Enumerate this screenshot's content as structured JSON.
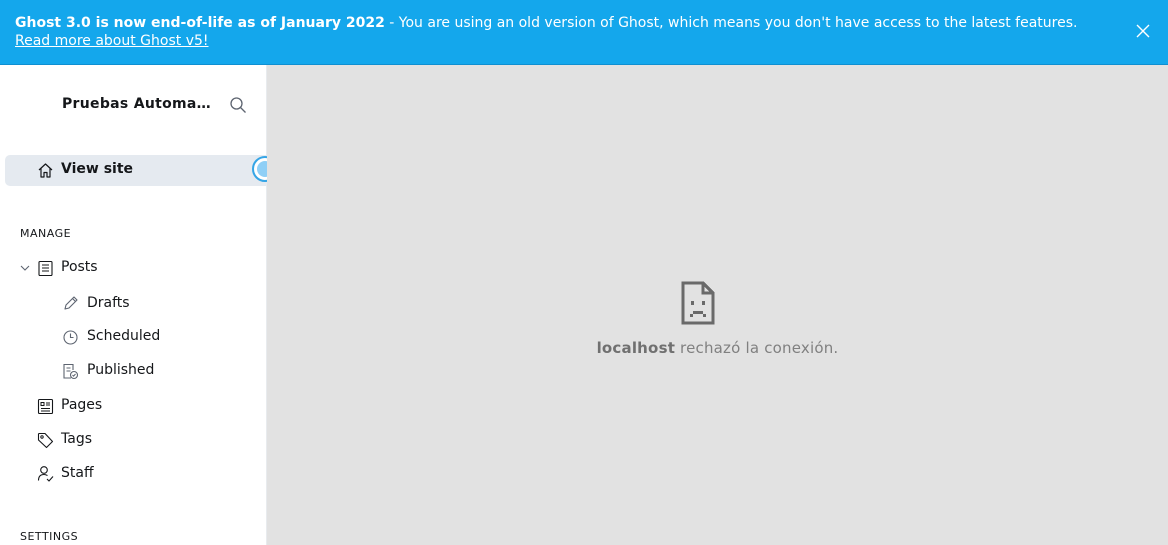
{
  "banner": {
    "bold_text": "Ghost 3.0 is now end-of-life as of January 2022",
    "message": " - You are using an old version of Ghost, which means you don't have access to the latest features. ",
    "link_text": "Read more about Ghost v5!"
  },
  "sidebar": {
    "site_title": "Pruebas Automati...",
    "view_site": "View site",
    "manage_heading": "MANAGE",
    "settings_heading": "SETTINGS",
    "items": {
      "posts": "Posts",
      "drafts": "Drafts",
      "scheduled": "Scheduled",
      "published": "Published",
      "pages": "Pages",
      "tags": "Tags",
      "staff": "Staff"
    }
  },
  "main": {
    "error_host": "localhost",
    "error_message": " rechazó la conexión."
  },
  "colors": {
    "banner": "#14a7ec",
    "sidebar_active": "#e5eaf0",
    "content_bg": "#e2e2e2"
  },
  "icons": [
    "close-icon",
    "search-icon",
    "home-icon",
    "chevron-down-icon",
    "posts-icon",
    "pencil-icon",
    "clock-icon",
    "published-icon",
    "pages-icon",
    "tag-icon",
    "staff-icon",
    "sad-page-icon"
  ]
}
